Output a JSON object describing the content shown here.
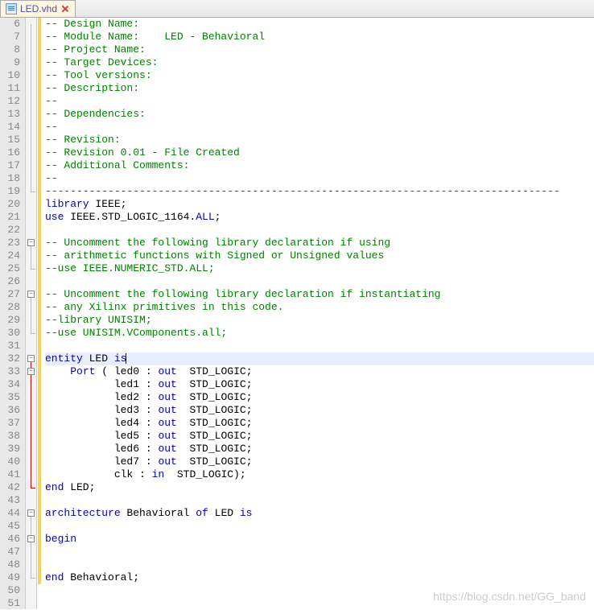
{
  "tab": {
    "filename": "LED.vhd"
  },
  "watermark": "https://blog.csdn.net/GG_band",
  "gutter_start": 6,
  "gutter_end": 51,
  "highlight_line": 32,
  "code_lines": [
    {
      "n": 6,
      "cls": "",
      "html": "<span class='tok-comment'>-- Design Name: </span>"
    },
    {
      "n": 7,
      "cls": "",
      "html": "<span class='tok-comment'>-- Module Name:    LED - Behavioral </span>"
    },
    {
      "n": 8,
      "cls": "",
      "html": "<span class='tok-comment'>-- Project Name: </span>"
    },
    {
      "n": 9,
      "cls": "",
      "html": "<span class='tok-comment'>-- Target Devices: </span>"
    },
    {
      "n": 10,
      "cls": "",
      "html": "<span class='tok-comment'>-- Tool versions: </span>"
    },
    {
      "n": 11,
      "cls": "",
      "html": "<span class='tok-comment'>-- Description: </span>"
    },
    {
      "n": 12,
      "cls": "",
      "html": "<span class='tok-comment'>--</span>"
    },
    {
      "n": 13,
      "cls": "",
      "html": "<span class='tok-comment'>-- Dependencies: </span>"
    },
    {
      "n": 14,
      "cls": "",
      "html": "<span class='tok-comment'>--</span>"
    },
    {
      "n": 15,
      "cls": "",
      "html": "<span class='tok-comment'>-- Revision: </span>"
    },
    {
      "n": 16,
      "cls": "",
      "html": "<span class='tok-comment'>-- Revision 0.01 - File Created</span>"
    },
    {
      "n": 17,
      "cls": "",
      "html": "<span class='tok-comment'>-- Additional Comments: </span>"
    },
    {
      "n": 18,
      "cls": "",
      "html": "<span class='tok-comment'>--</span>"
    },
    {
      "n": 19,
      "cls": "",
      "html": "<span class='tok-comment'>----------------------------------------------------------------------------------</span>"
    },
    {
      "n": 20,
      "cls": "",
      "html": "<span class='tok-keyword'>library</span> IEEE;"
    },
    {
      "n": 21,
      "cls": "",
      "html": "<span class='tok-keyword'>use</span> IEEE.STD_LOGIC_1164.<span class='tok-keyword'>ALL</span>;"
    },
    {
      "n": 22,
      "cls": "",
      "html": ""
    },
    {
      "n": 23,
      "cls": "",
      "html": "<span class='tok-comment'>-- Uncomment the following library declaration if using</span>"
    },
    {
      "n": 24,
      "cls": "",
      "html": "<span class='tok-comment'>-- arithmetic functions with Signed or Unsigned values</span>"
    },
    {
      "n": 25,
      "cls": "",
      "html": "<span class='tok-comment'>--use IEEE.NUMERIC_STD.ALL;</span>"
    },
    {
      "n": 26,
      "cls": "",
      "html": ""
    },
    {
      "n": 27,
      "cls": "",
      "html": "<span class='tok-comment'>-- Uncomment the following library declaration if instantiating</span>"
    },
    {
      "n": 28,
      "cls": "",
      "html": "<span class='tok-comment'>-- any Xilinx primitives in this code.</span>"
    },
    {
      "n": 29,
      "cls": "",
      "html": "<span class='tok-comment'>--library UNISIM;</span>"
    },
    {
      "n": 30,
      "cls": "",
      "html": "<span class='tok-comment'>--use UNISIM.VComponents.all;</span>"
    },
    {
      "n": 31,
      "cls": "",
      "html": ""
    },
    {
      "n": 32,
      "cls": "line-hl",
      "html": "<span class='tok-keyword'>entity</span> LED <span class='tok-keyword'>is</span><span class='caret'></span>"
    },
    {
      "n": 33,
      "cls": "",
      "html": "    <span class='tok-keyword'>Port</span> ( led0 : <span class='tok-keyword'>out</span>  STD_LOGIC;"
    },
    {
      "n": 34,
      "cls": "",
      "html": "           led1 : <span class='tok-keyword'>out</span>  STD_LOGIC;"
    },
    {
      "n": 35,
      "cls": "",
      "html": "           led2 : <span class='tok-keyword'>out</span>  STD_LOGIC;"
    },
    {
      "n": 36,
      "cls": "",
      "html": "           led3 : <span class='tok-keyword'>out</span>  STD_LOGIC;"
    },
    {
      "n": 37,
      "cls": "",
      "html": "           led4 : <span class='tok-keyword'>out</span>  STD_LOGIC;"
    },
    {
      "n": 38,
      "cls": "",
      "html": "           led5 : <span class='tok-keyword'>out</span>  STD_LOGIC;"
    },
    {
      "n": 39,
      "cls": "",
      "html": "           led6 : <span class='tok-keyword'>out</span>  STD_LOGIC;"
    },
    {
      "n": 40,
      "cls": "",
      "html": "           led7 : <span class='tok-keyword'>out</span>  STD_LOGIC;"
    },
    {
      "n": 41,
      "cls": "",
      "html": "           clk : <span class='tok-keyword'>in</span>  STD_LOGIC);"
    },
    {
      "n": 42,
      "cls": "",
      "html": "<span class='tok-keyword'>end</span> LED;"
    },
    {
      "n": 43,
      "cls": "",
      "html": ""
    },
    {
      "n": 44,
      "cls": "",
      "html": "<span class='tok-keyword'>architecture</span> Behavioral <span class='tok-keyword'>of</span> LED <span class='tok-keyword'>is</span>"
    },
    {
      "n": 45,
      "cls": "",
      "html": ""
    },
    {
      "n": 46,
      "cls": "",
      "html": "<span class='tok-keyword'>begin</span>"
    },
    {
      "n": 47,
      "cls": "",
      "html": ""
    },
    {
      "n": 48,
      "cls": "",
      "html": ""
    },
    {
      "n": 49,
      "cls": "",
      "html": "<span class='tok-keyword'>end</span> Behavioral;"
    },
    {
      "n": 50,
      "cls": "",
      "html": ""
    },
    {
      "n": 51,
      "cls": "",
      "html": ""
    }
  ],
  "fold_markers": [
    {
      "line": 23,
      "type": "box"
    },
    {
      "line": 27,
      "type": "box"
    },
    {
      "line": 32,
      "type": "box"
    },
    {
      "line": 33,
      "type": "box"
    },
    {
      "line": 44,
      "type": "box"
    },
    {
      "line": 46,
      "type": "box"
    }
  ],
  "fold_segments": [
    {
      "from": 6,
      "to": 19,
      "color": "#bbb"
    },
    {
      "from": 23,
      "to": 25,
      "color": "#bbb"
    },
    {
      "from": 27,
      "to": 30,
      "color": "#bbb"
    },
    {
      "from": 32,
      "to": 42,
      "color": "#d00"
    },
    {
      "from": 44,
      "to": 49,
      "color": "#bbb"
    }
  ]
}
